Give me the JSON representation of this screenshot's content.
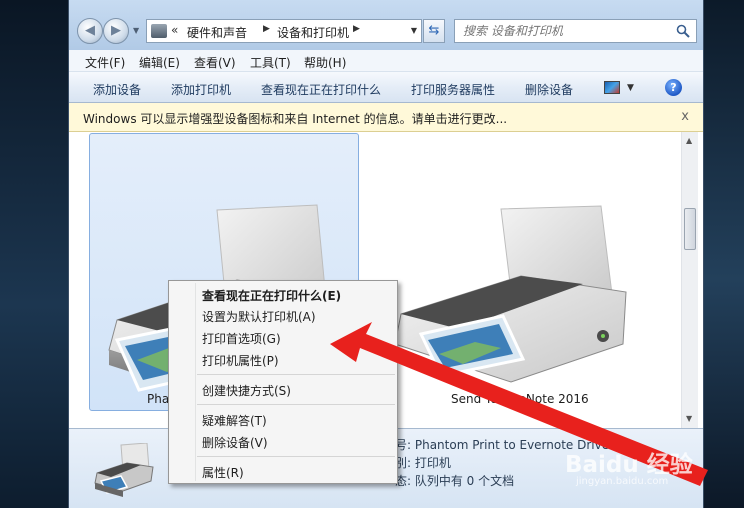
{
  "nav": {
    "breadcrumb": [
      "硬件和声音",
      "设备和打印机"
    ],
    "overflow": "«",
    "search_placeholder": "搜索 设备和打印机"
  },
  "menu": [
    "文件(F)",
    "编辑(E)",
    "查看(V)",
    "工具(T)",
    "帮助(H)"
  ],
  "toolbar": [
    "添加设备",
    "添加打印机",
    "查看现在正在打印什么",
    "打印服务器属性",
    "删除设备"
  ],
  "infobar": {
    "text": "Windows 可以显示增强型设备图标和来自 Internet 的信息。请单击进行更改...",
    "close": "x"
  },
  "devices": [
    {
      "label": "Pha",
      "selected": true
    },
    {
      "label": "Send To OneNote 2016",
      "selected": false
    }
  ],
  "details": {
    "line1": "号: Phantom Print to Evernote Driver",
    "line2": "別: 打印机",
    "line3": "态: 队列中有 0 个文档"
  },
  "context_menu": {
    "items": [
      {
        "label": "查看现在正在打印什么(E)",
        "bold": true
      },
      {
        "label": "设置为默认打印机(A)"
      },
      {
        "label": "打印首选项(G)"
      },
      {
        "label": "打印机属性(P)"
      },
      {
        "label": "创建快捷方式(S)"
      },
      {
        "label": "疑难解答(T)"
      },
      {
        "label": "删除设备(V)"
      },
      {
        "label": "属性(R)"
      }
    ]
  },
  "annotation": {
    "arrow_color": "#e8211d"
  },
  "watermark": {
    "brand": "Baidu 经验",
    "url": "jingyan.baidu.com"
  }
}
